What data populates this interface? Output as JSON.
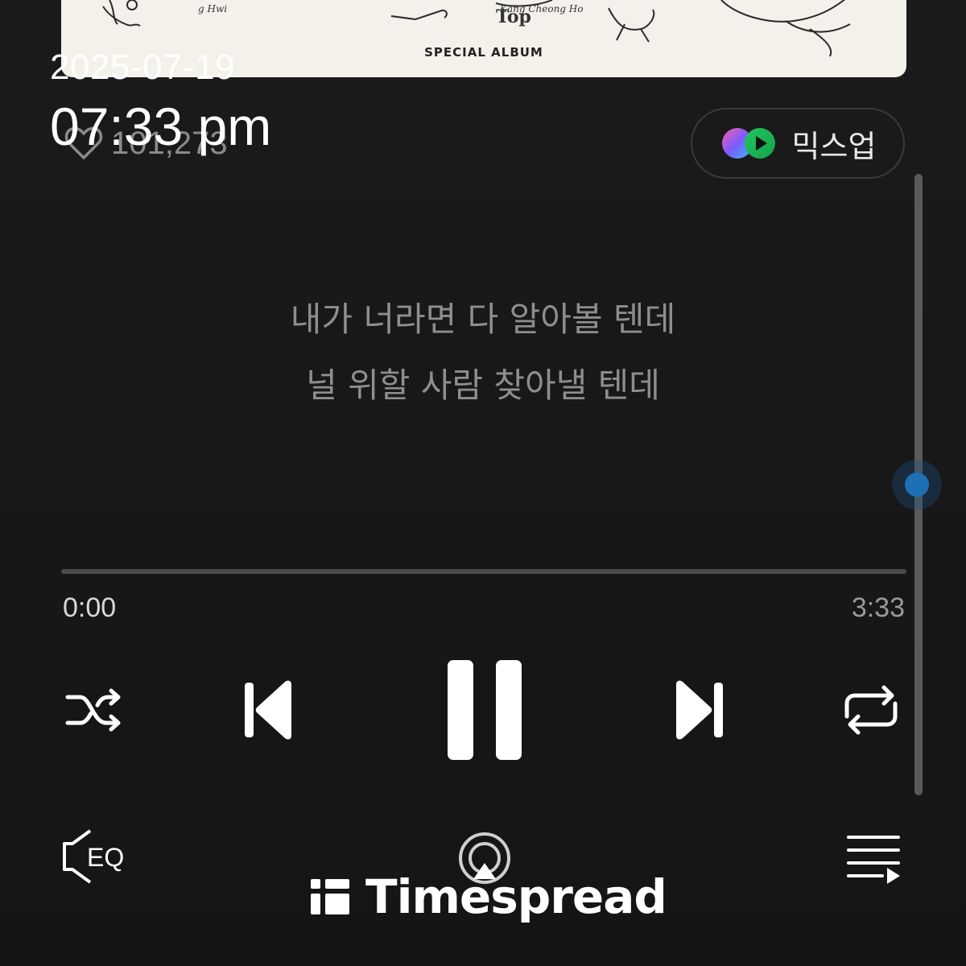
{
  "album": {
    "label": "SPECIAL ALBUM",
    "cover_text": "Top"
  },
  "overlay": {
    "date": "2025-07-19",
    "time": "07:33 pm"
  },
  "like": {
    "count": "101,273",
    "icon": "heart-icon"
  },
  "mixup": {
    "label": "믹스업",
    "icon": "mixup-logo-icon",
    "colors": [
      "#7b5cff",
      "#22c55e"
    ]
  },
  "lyrics": {
    "lines": [
      "내가 너라면 다 알아볼 텐데",
      "널 위할 사람 찾아낼 텐데"
    ]
  },
  "player": {
    "elapsed": "0:00",
    "total": "3:33",
    "progress": 0
  },
  "controls": {
    "shuffle_icon": "shuffle-icon",
    "prev_icon": "skip-previous-icon",
    "pause_icon": "pause-icon",
    "next_icon": "skip-next-icon",
    "repeat_icon": "repeat-icon",
    "eq_label": "EQ",
    "cast_icon": "airplay-icon",
    "playlist_icon": "playlist-icon"
  },
  "scrollbar": {
    "accent": "#1f6fb5"
  },
  "watermark": {
    "text": "Timespread"
  }
}
